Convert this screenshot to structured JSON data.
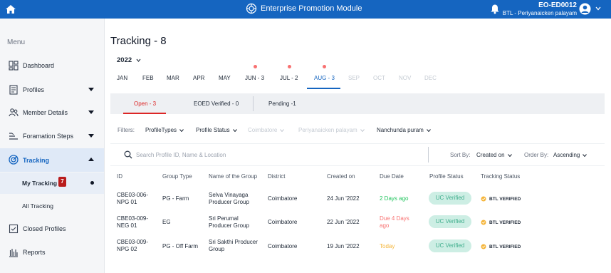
{
  "header": {
    "app_title": "Enterprise Promotion Module",
    "user_id": "EO-ED0012",
    "user_location": "BTL - Periyanaicken palayam"
  },
  "sidebar": {
    "menu_title": "Menu",
    "items": [
      {
        "label": "Dashboard",
        "icon": "dashboard-icon"
      },
      {
        "label": "Profiles",
        "icon": "profiles-icon"
      },
      {
        "label": "Member Details",
        "icon": "members-icon"
      },
      {
        "label": "Foramation Steps",
        "icon": "steps-icon"
      },
      {
        "label": "Tracking",
        "icon": "tracking-icon"
      },
      {
        "label": "Closed Profiles",
        "icon": "closed-profiles-icon"
      },
      {
        "label": "Reports",
        "icon": "reports-icon"
      }
    ],
    "tracking_sub": [
      {
        "label": "My Tracking",
        "badge": "7"
      },
      {
        "label": "All Tracking"
      }
    ]
  },
  "page": {
    "title": "Tracking - 8",
    "year": "2022",
    "months": [
      "JAN",
      "FEB",
      "MAR",
      "APR",
      "MAY",
      "JUN - 3",
      "JUL - 2",
      "AUG - 3",
      "SEP",
      "OCT",
      "NOV",
      "DEC"
    ],
    "active_month": "AUG - 3"
  },
  "status_tabs": [
    "Open - 3",
    "EOED Verified - 0",
    "Pending -1"
  ],
  "filters": {
    "label": "Filters:",
    "items": [
      "ProfileTypes",
      "Profile Status",
      "Coimbatore",
      "Periyanaicken palayam",
      "Nanchunda puram"
    ]
  },
  "search": {
    "placeholder": "Search Profile ID, Name & Location",
    "sort_by_label": "Sort By:",
    "sort_by_value": "Created on",
    "order_by_label": "Order By:",
    "order_by_value": "Ascending"
  },
  "table": {
    "columns": [
      "ID",
      "Group Type",
      "Name of the Group",
      "District",
      "Created on",
      "Due Date",
      "Profile Status",
      "Tracking Status"
    ],
    "rows": [
      {
        "id": [
          "CBE03-006-",
          "NPG 01"
        ],
        "group_type": "PG - Farm",
        "name": [
          "Selva Vinayaga",
          "Producer Group"
        ],
        "district": "Coimbatore",
        "created_on": "24 Jun '2022",
        "due_date": [
          "2 Days ago"
        ],
        "profile_status": "UC Verified",
        "tracking_status": "BTL VERIFIED"
      },
      {
        "id": [
          "CBE03-009-",
          "NEG 01"
        ],
        "group_type": "EG",
        "name": [
          "Sri Perumal",
          "Producer Group"
        ],
        "district": "Coimbatore",
        "created_on": "22 Jun '2022",
        "due_date": [
          "Due 4 Days",
          "ago"
        ],
        "profile_status": "UC Verified",
        "tracking_status": "BTL VERIFIED"
      },
      {
        "id": [
          "CBE03-009-",
          "NPG 02"
        ],
        "group_type": "PG - Off Farm",
        "name": [
          "Sri Sakthi Producer",
          "Group"
        ],
        "district": "Coimbatore",
        "created_on": "19 Jun '2022",
        "due_date": [
          "Today"
        ],
        "profile_status": "UC Verified",
        "tracking_status": "BTL VERIFIED"
      }
    ]
  },
  "colors": {
    "primary": "#1565c0",
    "danger": "#dc2626",
    "pill_bg": "#cdeee4",
    "pill_text": "#3fae8c",
    "tracking_icon": "#f5b53a"
  }
}
